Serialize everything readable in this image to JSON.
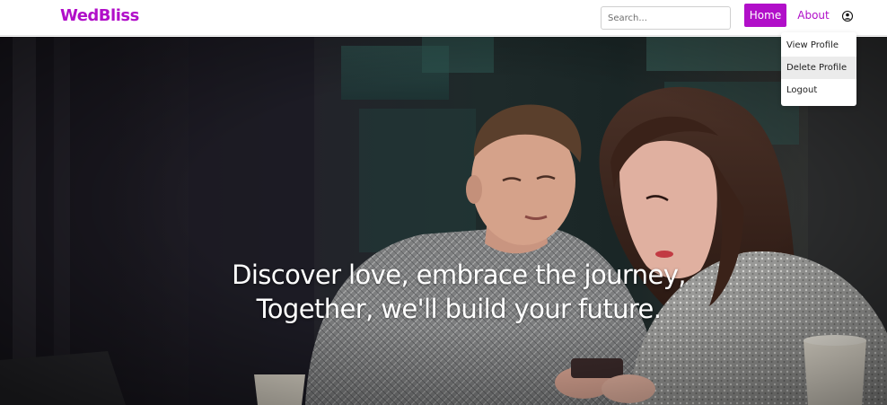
{
  "navbar": {
    "brand": "WedBliss",
    "search_placeholder": "Search...",
    "home_label": "Home",
    "about_label": "About",
    "user_icon": "user-circle-icon"
  },
  "user_menu": {
    "items": [
      {
        "label": "View Profile"
      },
      {
        "label": "Delete Profile"
      },
      {
        "label": "Logout"
      }
    ]
  },
  "hero": {
    "line1": "Discover love, embrace the journey,",
    "line2": "Together, we'll build your future."
  },
  "colors": {
    "brand": "#b10fc9",
    "nav_active_bg": "#b10fc9",
    "menu_hover_bg": "#ebebeb"
  }
}
